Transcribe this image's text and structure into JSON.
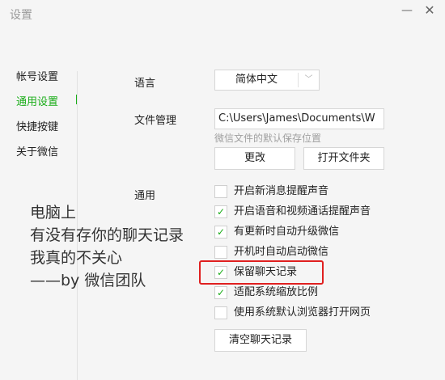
{
  "window": {
    "title": "设置",
    "minimize_glyph": "—",
    "close_glyph": "✕"
  },
  "sidebar": {
    "items": [
      {
        "label": "帐号设置",
        "active": false
      },
      {
        "label": "通用设置",
        "active": true
      },
      {
        "label": "快捷按键",
        "active": false
      },
      {
        "label": "关于微信",
        "active": false
      }
    ]
  },
  "general": {
    "language_label": "语言",
    "language_value": "简体中文",
    "language_arrow": "﹀",
    "file_label": "文件管理",
    "file_path": "C:\\Users\\James\\Documents\\W",
    "file_hint": "微信文件的默认保存位置",
    "change_button": "更改",
    "open_folder_button": "打开文件夹",
    "general_label": "通用",
    "check_glyph": "✓",
    "options": [
      {
        "label": "开启新消息提醒声音",
        "checked": false
      },
      {
        "label": "开启语音和视频通话提醒声音",
        "checked": true
      },
      {
        "label": "有更新时自动升级微信",
        "checked": true
      },
      {
        "label": "开机时自动启动微信",
        "checked": false
      },
      {
        "label": "保留聊天记录",
        "checked": true
      },
      {
        "label": "适配系统缩放比例",
        "checked": true
      },
      {
        "label": "使用系统默认浏览器打开网页",
        "checked": false
      }
    ],
    "clear_button": "清空聊天记录"
  },
  "overlay": {
    "lines": [
      "电脑上",
      "有没有存你的聊天记录",
      "我真的不关心",
      "——by 微信团队"
    ]
  },
  "colors": {
    "accent": "#1aad19",
    "highlight": "#e02020"
  }
}
